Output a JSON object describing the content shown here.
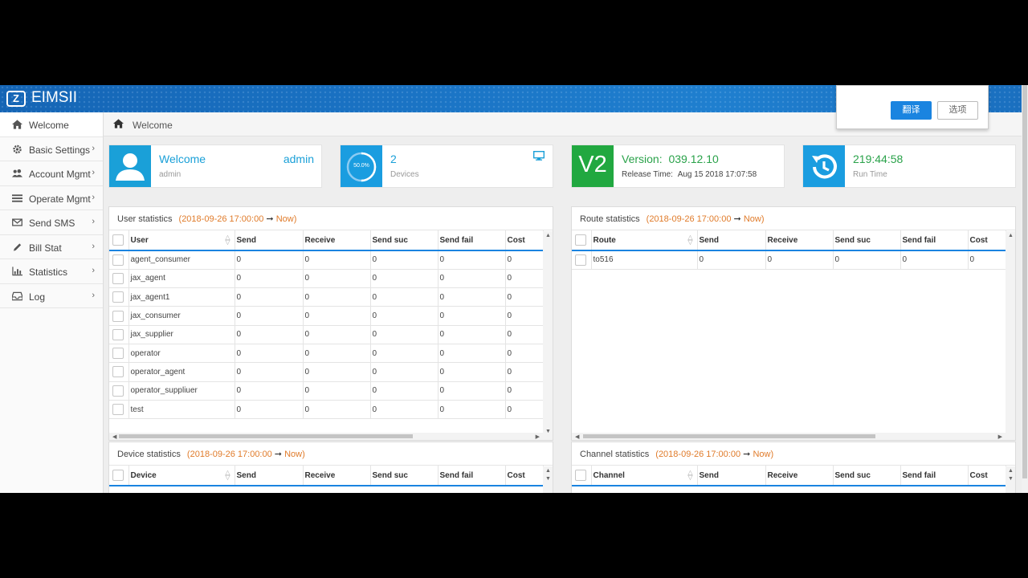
{
  "header": {
    "app_title": "EIMSII",
    "logo_text": "Z"
  },
  "popup": {
    "translate_label": "翻译",
    "options_label": "选项"
  },
  "sidebar": {
    "items": [
      {
        "label": "Welcome",
        "icon": "home-icon",
        "chevron": ""
      },
      {
        "label": "Basic Settings",
        "icon": "gear-icon",
        "chevron": "›"
      },
      {
        "label": "Account Mgmt",
        "icon": "users-icon",
        "chevron": "›"
      },
      {
        "label": "Operate Mgmt",
        "icon": "list-icon",
        "chevron": "›"
      },
      {
        "label": "Send SMS",
        "icon": "envelope-icon",
        "chevron": "›"
      },
      {
        "label": "Bill Stat",
        "icon": "pencil-icon",
        "chevron": "›"
      },
      {
        "label": "Statistics",
        "icon": "bar-chart-icon",
        "chevron": "›"
      },
      {
        "label": "Log",
        "icon": "inbox-icon",
        "chevron": "›"
      }
    ]
  },
  "breadcrumb": {
    "text": "Welcome"
  },
  "cards": {
    "welcome": {
      "title": "Welcome",
      "user": "admin",
      "sub": "admin"
    },
    "devices": {
      "count": "2",
      "label": "Devices",
      "percent": "50.0%",
      "progress": 0.5
    },
    "version": {
      "badge": "V2",
      "version_label": "Version:",
      "version": "039.12.10",
      "release_label": "Release Time:",
      "release_time": "Aug 15 2018 17:07:58"
    },
    "runtime": {
      "value": "219:44:58",
      "label": "Run Time"
    }
  },
  "panels": {
    "user_stats": {
      "title": "User statistics",
      "range_start": "(2018-09-26 17:00:00",
      "arrow": "➞",
      "range_end": "Now)",
      "columns": [
        "User",
        "Send",
        "Receive",
        "Send suc",
        "Send fail",
        "Cost"
      ],
      "rows": [
        [
          "agent_consumer",
          "0",
          "0",
          "0",
          "0",
          "0"
        ],
        [
          "jax_agent",
          "0",
          "0",
          "0",
          "0",
          "0"
        ],
        [
          "jax_agent1",
          "0",
          "0",
          "0",
          "0",
          "0"
        ],
        [
          "jax_consumer",
          "0",
          "0",
          "0",
          "0",
          "0"
        ],
        [
          "jax_supplier",
          "0",
          "0",
          "0",
          "0",
          "0"
        ],
        [
          "operator",
          "0",
          "0",
          "0",
          "0",
          "0"
        ],
        [
          "operator_agent",
          "0",
          "0",
          "0",
          "0",
          "0"
        ],
        [
          "operator_suppliuer",
          "0",
          "0",
          "0",
          "0",
          "0"
        ],
        [
          "test",
          "0",
          "0",
          "0",
          "0",
          "0"
        ]
      ]
    },
    "route_stats": {
      "title": "Route statistics",
      "range_start": "(2018-09-26 17:00:00",
      "arrow": "➞",
      "range_end": "Now)",
      "columns": [
        "Route",
        "Send",
        "Receive",
        "Send suc",
        "Send fail",
        "Cost"
      ],
      "rows": [
        [
          "to516",
          "0",
          "0",
          "0",
          "0",
          "0"
        ]
      ]
    },
    "device_stats": {
      "title": "Device statistics",
      "range_start": "(2018-09-26 17:00:00",
      "arrow": "➞",
      "range_end": "Now)",
      "columns": [
        "Device",
        "Send",
        "Receive",
        "Send suc",
        "Send fail",
        "Cost"
      ],
      "rows": []
    },
    "channel_stats": {
      "title": "Channel statistics",
      "range_start": "(2018-09-26 17:00:00",
      "arrow": "➞",
      "range_end": "Now)",
      "columns": [
        "Channel",
        "Send",
        "Receive",
        "Send suc",
        "Send fail",
        "Cost"
      ],
      "rows": []
    }
  },
  "colors": {
    "header_blue": "#1a73c4",
    "accent_blue": "#1a84e0",
    "green": "#21a840",
    "orange": "#e07b2a",
    "welcome_text": "#1aa0d8",
    "version_text": "#2aa24a"
  }
}
